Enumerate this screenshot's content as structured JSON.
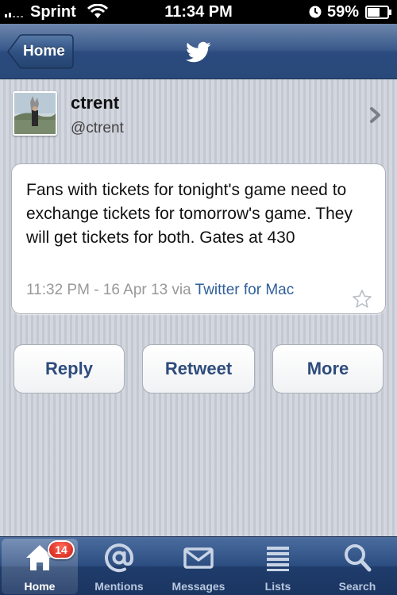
{
  "status_bar": {
    "carrier": "Sprint",
    "time": "11:34 PM",
    "battery_percent": "59%",
    "icons": [
      "signal-icon",
      "wifi-icon",
      "lock-icon",
      "battery-icon"
    ]
  },
  "nav": {
    "back_label": "Home",
    "logo_icon": "twitter-bird-icon"
  },
  "profile": {
    "display_name": "ctrent",
    "username": "@ctrent",
    "chevron_icon": "chevron-right-icon"
  },
  "tweet": {
    "text": "Fans with tickets for tonight's game need to exchange tickets for tomorrow's game. They will get tickets for both. Gates at 430",
    "time": "11:32 PM - 16 Apr 13 via ",
    "via_app": "Twitter for Mac",
    "favorite_icon": "star-icon"
  },
  "actions": {
    "reply_label": "Reply",
    "retweet_label": "Retweet",
    "more_label": "More"
  },
  "tab_bar": {
    "active": "home",
    "tabs": [
      {
        "label": "Home",
        "icon": "home-icon",
        "badge": "14"
      },
      {
        "label": "Mentions",
        "icon": "at-sign-icon"
      },
      {
        "label": "Messages",
        "icon": "envelope-icon"
      },
      {
        "label": "Lists",
        "icon": "list-icon"
      },
      {
        "label": "Search",
        "icon": "search-icon"
      }
    ]
  },
  "colors": {
    "nav_blue": "#2b4b7e",
    "link_blue": "#2f5f9c",
    "button_text": "#2e4c7c",
    "badge_red": "#d01b13",
    "background": "#c9ced8"
  }
}
